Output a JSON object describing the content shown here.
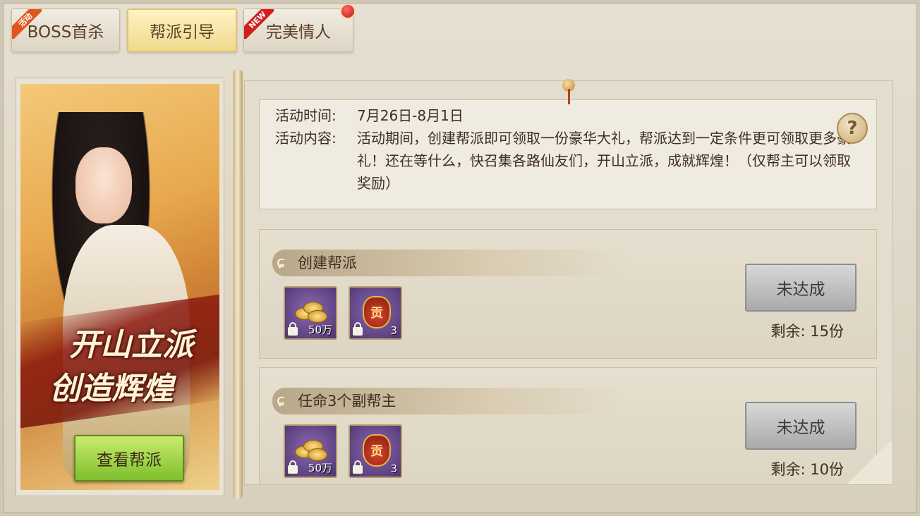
{
  "tabs": [
    {
      "label": "BOSS首杀",
      "ribbon": "活动",
      "active": false
    },
    {
      "label": "帮派引导",
      "active": true
    },
    {
      "label": "完美情人",
      "ribbon": "NEW",
      "badge": "red-dot",
      "active": false
    }
  ],
  "banner": {
    "slogan_line1": "开山立派",
    "slogan_line2": "创造辉煌",
    "view_button": "查看帮派"
  },
  "info": {
    "time_label": "活动时间:",
    "time_value": "7月26日-8月1日",
    "content_label": "活动内容:",
    "content_text": "活动期间，创建帮派即可领取一份豪华大礼，帮派达到一定条件更可领取更多豪礼！还在等什么，快召集各路仙友们，开山立派，成就辉煌！（仅帮主可以领取奖励）",
    "help_symbol": "?"
  },
  "tasks": [
    {
      "title": "创建帮派",
      "rewards": [
        {
          "icon": "gold-coins-icon",
          "qty": "50万"
        },
        {
          "icon": "contribution-bag-icon",
          "glyph": "贡",
          "qty": "3"
        }
      ],
      "status": "未达成",
      "remain": "剩余: 15份"
    },
    {
      "title": "任命3个副帮主",
      "rewards": [
        {
          "icon": "gold-coins-icon",
          "qty": "50万"
        },
        {
          "icon": "contribution-bag-icon",
          "glyph": "贡",
          "qty": "3"
        }
      ],
      "status": "未达成",
      "remain": "剩余: 10份"
    }
  ]
}
